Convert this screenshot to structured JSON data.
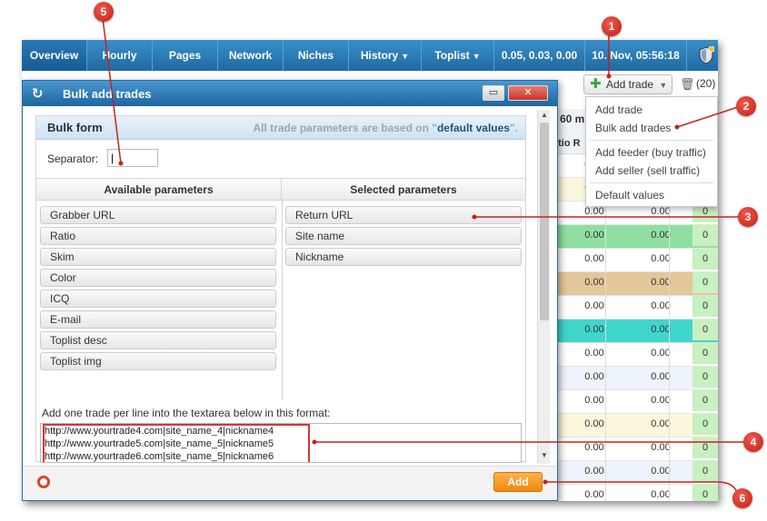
{
  "nav": {
    "items": [
      {
        "label": "Overview",
        "caret": false
      },
      {
        "label": "Hourly",
        "caret": false
      },
      {
        "label": "Pages",
        "caret": false
      },
      {
        "label": "Network",
        "caret": false
      },
      {
        "label": "Niches",
        "caret": false
      },
      {
        "label": "History",
        "caret": true
      },
      {
        "label": "Toplist",
        "caret": true
      },
      {
        "label": "0.05, 0.03, 0.00",
        "caret": false
      },
      {
        "label": "10. Nov,  05:56:18",
        "caret": false
      }
    ]
  },
  "toolbar": {
    "add_trade_label": "Add trade",
    "count": "(20)"
  },
  "dropdown": {
    "group1": [
      "Add trade",
      "Bulk add trades"
    ],
    "group2": [
      "Add feeder (buy traffic)",
      "Add seller (sell traffic)"
    ],
    "group3": [
      "Default values"
    ]
  },
  "grid": {
    "head_60": "60 m",
    "head_ratio": "atio R",
    "rows": [
      {
        "a": "0.00",
        "b": "0.00",
        "c": "0",
        "bg": "#ffffff"
      },
      {
        "a": "0.00",
        "b": "0.00",
        "c": "0",
        "bg": "#fbf7dc"
      },
      {
        "a": "0.00",
        "b": "0.00",
        "c": "0",
        "bg": "#ffffff"
      },
      {
        "a": "0.00",
        "b": "0.00",
        "c": "0",
        "bg": "#8fe0a0"
      },
      {
        "a": "0.00",
        "b": "0.00",
        "c": "0",
        "bg": "#ffffff"
      },
      {
        "a": "0.00",
        "b": "0.00",
        "c": "0",
        "bg": "#e4c79a"
      },
      {
        "a": "0.00",
        "b": "0.00",
        "c": "0",
        "bg": "#ffffff"
      },
      {
        "a": "0.00",
        "b": "0.00",
        "c": "0",
        "bg": "#3fd6cc"
      },
      {
        "a": "0.00",
        "b": "0.00",
        "c": "0",
        "bg": "#ffffff"
      },
      {
        "a": "0.00",
        "b": "0.00",
        "c": "0",
        "bg": "#eef4fb"
      },
      {
        "a": "0.00",
        "b": "0.00",
        "c": "0",
        "bg": "#ffffff"
      },
      {
        "a": "0.00",
        "b": "0.00",
        "c": "0",
        "bg": "#fbf7dc"
      },
      {
        "a": "0.00",
        "b": "0.00",
        "c": "0",
        "bg": "#ffffff"
      },
      {
        "a": "0.00",
        "b": "0.00",
        "c": "0",
        "bg": "#eef4fb"
      },
      {
        "a": "0.00",
        "b": "0.00",
        "c": "0",
        "bg": "#ffffff"
      },
      {
        "a": "0.00",
        "b": "0.00",
        "c": "0",
        "bg": "#ffffff"
      }
    ]
  },
  "modal": {
    "title": "Bulk add trades",
    "bulk_form_title": "Bulk form",
    "note_prefix": "All trade parameters are based on \"",
    "note_link": "default values",
    "note_suffix": "\".",
    "separator_label": "Separator:",
    "separator_value": "|",
    "available_header": "Available parameters",
    "selected_header": "Selected parameters",
    "available": [
      "Grabber URL",
      "Ratio",
      "Skim",
      "Color",
      "ICQ",
      "E-mail",
      "Toplist desc",
      "Toplist img"
    ],
    "selected": [
      "Return URL",
      "Site name",
      "Nickname"
    ],
    "format_label": "Add one trade per line into the textarea below in this format:",
    "textarea_lines": [
      "http://www.yourtrade4.com|site_name_4|nickname4",
      "http://www.yourtrade5.com|site_name_5|nickname5",
      "http://www.yourtrade6.com|site_name_5|nickname6"
    ],
    "add_label": "Add"
  },
  "callouts": [
    "1",
    "2",
    "3",
    "4",
    "5",
    "6"
  ],
  "colors": {
    "nav": "#1f6aa3",
    "accent_orange": "#f2860e",
    "callout_red": "#d62b1f",
    "green_col": "#c8f0c0"
  }
}
